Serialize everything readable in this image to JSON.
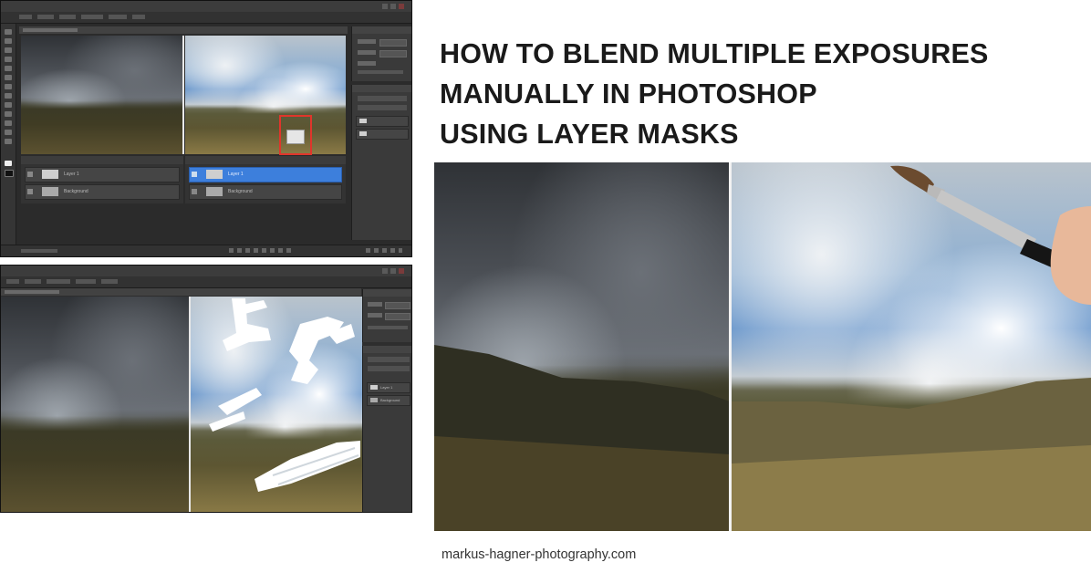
{
  "article": {
    "title_lines": [
      "HOW TO BLEND MULTIPLE EXPOSURES",
      "MANUALLY IN PHOTOSHOP",
      "USING LAYER MASKS"
    ],
    "source_url": "markus-hagner-photography.com"
  },
  "screenshots": {
    "top": {
      "layers": [
        {
          "label": "Layer 1"
        },
        {
          "label": "Background"
        },
        {
          "label": "Layer 1"
        },
        {
          "label": "Background"
        }
      ]
    },
    "bottom": {
      "layers": [
        {
          "label": "Layer 1"
        },
        {
          "label": "Background"
        }
      ]
    }
  },
  "colors": {
    "selected_layer": "#3d7fdc",
    "highlight_box": "#e0352b",
    "ps_background": "#2b2b2b"
  }
}
